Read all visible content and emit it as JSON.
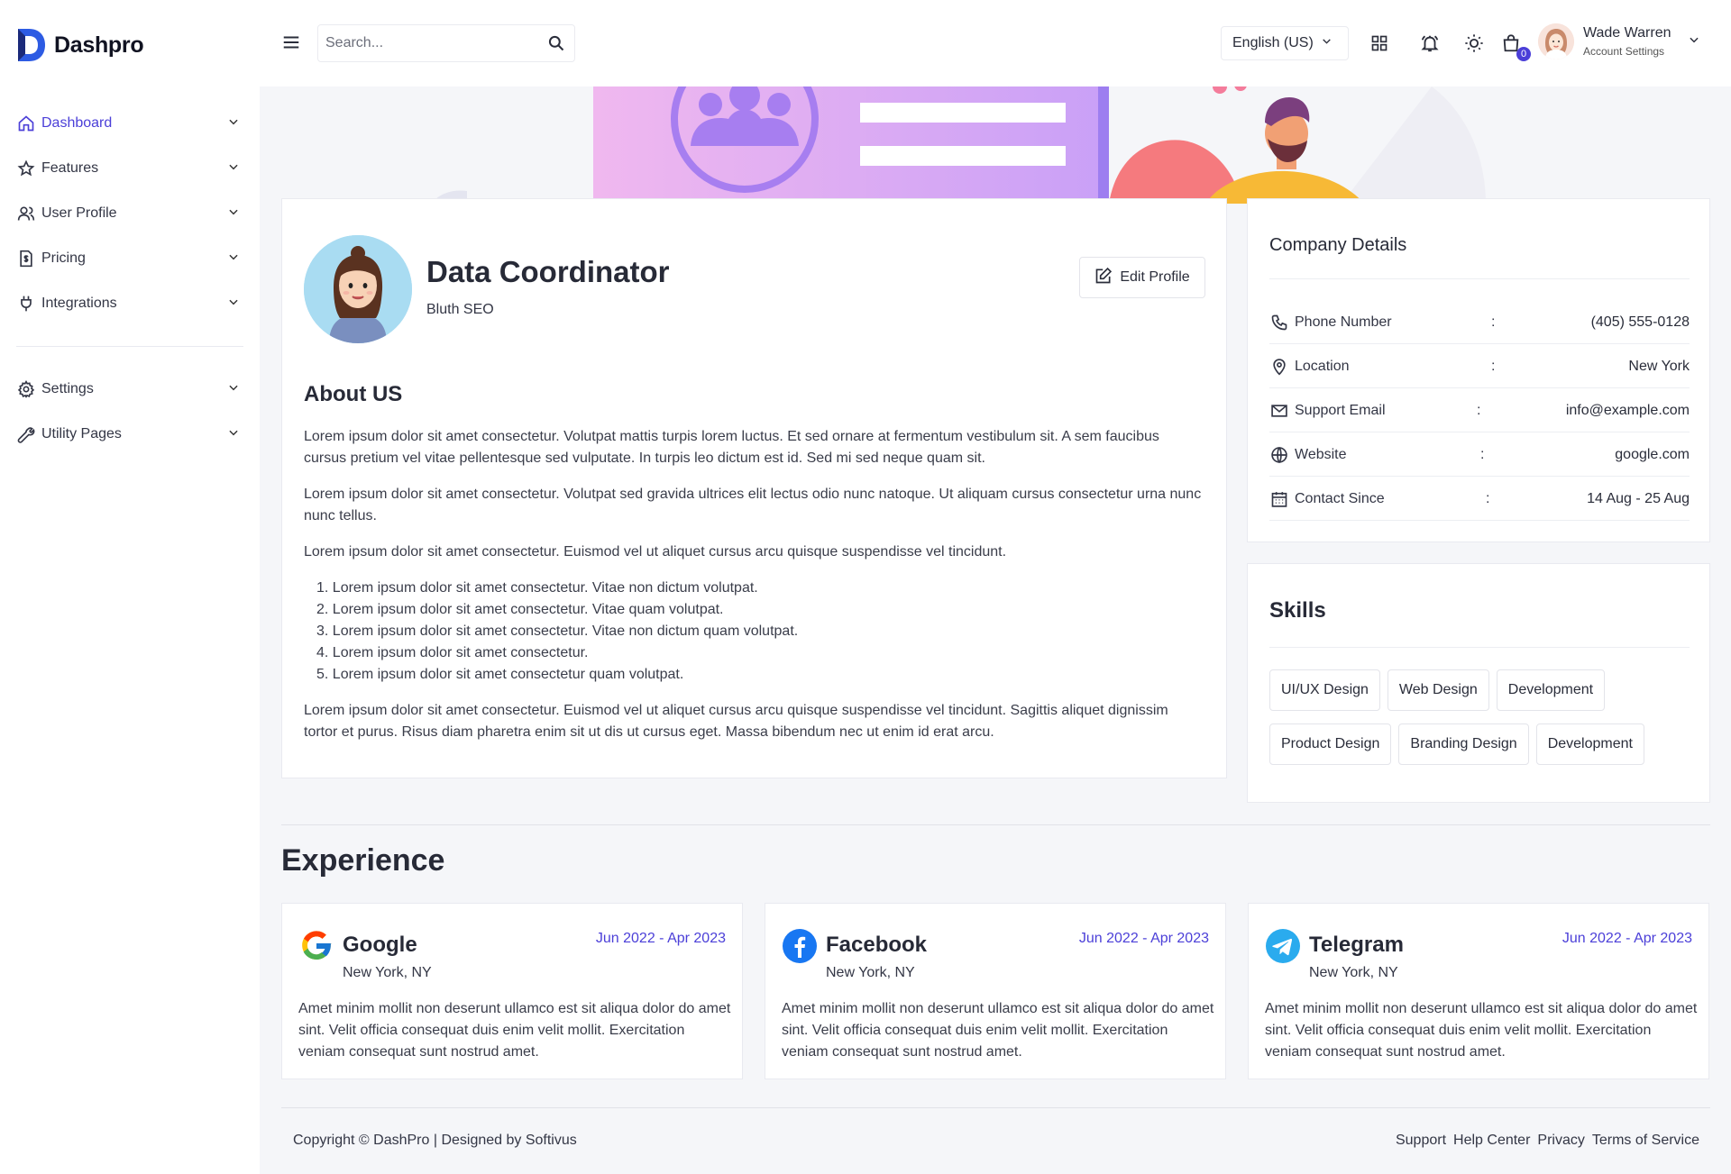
{
  "brand": {
    "name": "Dashpro"
  },
  "sidebar": {
    "items": [
      {
        "label": "Dashboard",
        "icon": "home-icon",
        "active": true
      },
      {
        "label": "Features",
        "icon": "star-icon"
      },
      {
        "label": "User Profile",
        "icon": "users-icon"
      },
      {
        "label": "Pricing",
        "icon": "invoice-icon"
      },
      {
        "label": "Integrations",
        "icon": "plug-icon"
      },
      {
        "label": "Settings",
        "icon": "gear-icon"
      },
      {
        "label": "Utility Pages",
        "icon": "tools-icon"
      }
    ]
  },
  "header": {
    "search_placeholder": "Search...",
    "language": "English (US)",
    "cart_count": "0",
    "user_name": "Wade Warren",
    "user_sub": "Account Settings"
  },
  "profile": {
    "name": "Data Coordinator",
    "company": "Bluth SEO",
    "edit_label": "Edit Profile",
    "about_title": "About US",
    "paragraphs": [
      "Lorem ipsum dolor sit amet consectetur. Volutpat mattis turpis lorem luctus. Et sed ornare at fermentum vestibulum sit. A sem faucibus cursus pretium vel vitae pellentesque sed vulputate. In turpis leo dictum est id. Sed mi sed neque quam sit.",
      "Lorem ipsum dolor sit amet consectetur. Volutpat sed gravida ultrices elit lectus odio nunc natoque. Ut aliquam cursus consectetur urna nunc nunc tellus.",
      "Lorem ipsum dolor sit amet consectetur. Euismod vel ut aliquet cursus arcu quisque suspendisse vel tincidunt."
    ],
    "list": [
      "Lorem ipsum dolor sit amet consectetur. Vitae non dictum volutpat.",
      "Lorem ipsum dolor sit amet consectetur. Vitae quam volutpat.",
      "Lorem ipsum dolor sit amet consectetur. Vitae non dictum quam volutpat.",
      "Lorem ipsum dolor sit amet consectetur.",
      "Lorem ipsum dolor sit amet consectetur quam volutpat."
    ],
    "closing": "Lorem ipsum dolor sit amet consectetur. Euismod vel ut aliquet cursus arcu quisque suspendisse vel tincidunt. Sagittis aliquet dignissim tortor et purus. Risus diam pharetra enim sit ut dis ut cursus eget. Massa bibendum nec ut enim id erat arcu."
  },
  "company": {
    "title": "Company Details",
    "rows": [
      {
        "label": "Phone Number",
        "colon": ":",
        "value": "(405) 555-0128",
        "icon": "phone-icon"
      },
      {
        "label": "Location",
        "colon": ":",
        "value": "New York",
        "icon": "location-pin-icon"
      },
      {
        "label": "Support Email",
        "colon": ":",
        "value": "info@example.com",
        "icon": "mail-icon"
      },
      {
        "label": "Website",
        "colon": ":",
        "value": "google.com",
        "icon": "globe-icon"
      },
      {
        "label": "Contact Since",
        "colon": ":",
        "value": "14 Aug - 25 Aug",
        "icon": "calendar-icon"
      }
    ]
  },
  "skills": {
    "title": "Skills",
    "items": [
      "UI/UX Design",
      "Web Design",
      "Development",
      "Product Design",
      "Branding Design",
      "Development"
    ]
  },
  "experience": {
    "title": "Experience",
    "items": [
      {
        "company": "Google",
        "location": "New York, NY",
        "date": "Jun 2022 - Apr 2023",
        "desc": "Amet minim mollit non deserunt ullamco est sit aliqua dolor do amet sint. Velit officia consequat duis enim velit mollit. Exercitation veniam consequat sunt nostrud amet."
      },
      {
        "company": "Facebook",
        "location": "New York, NY",
        "date": "Jun 2022 - Apr 2023",
        "desc": "Amet minim mollit non deserunt ullamco est sit aliqua dolor do amet sint. Velit officia consequat duis enim velit mollit. Exercitation veniam consequat sunt nostrud amet."
      },
      {
        "company": "Telegram",
        "location": "New York, NY",
        "date": "Jun 2022 - Apr 2023",
        "desc": "Amet minim mollit non deserunt ullamco est sit aliqua dolor do amet sint. Velit officia consequat duis enim velit mollit. Exercitation veniam consequat sunt nostrud amet."
      }
    ]
  },
  "footer": {
    "copyright": "Copyright © DashPro | Designed by Softivus",
    "links": [
      "Support",
      "Help Center",
      "Privacy",
      "Terms of Service"
    ]
  },
  "colors": {
    "accent": "#4b3fd8",
    "background": "#f5f6f9"
  }
}
